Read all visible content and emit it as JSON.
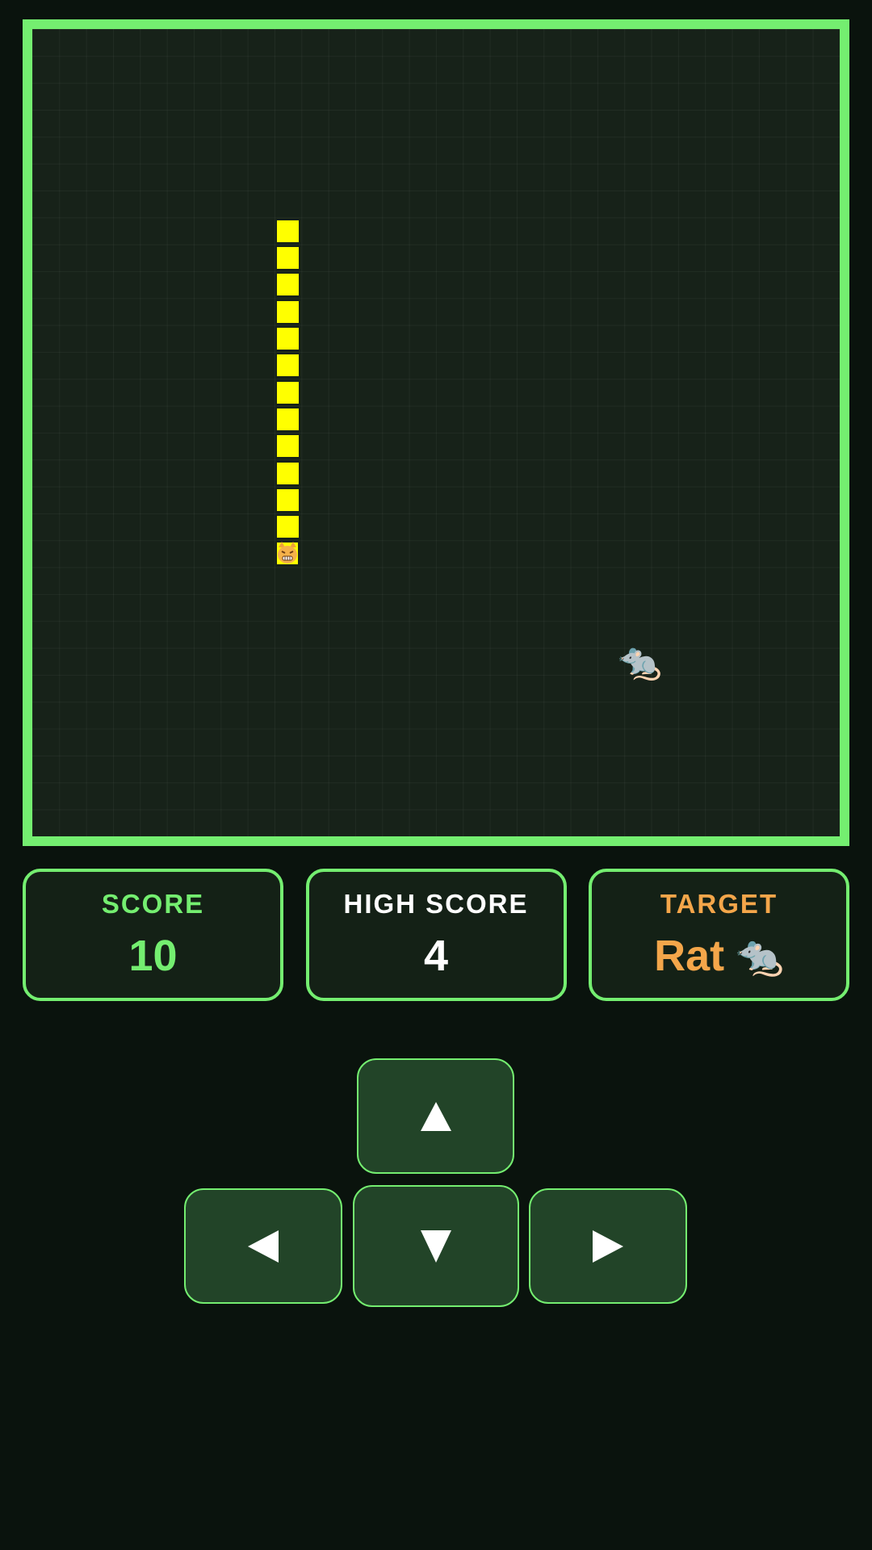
{
  "board": {
    "grid": {
      "columns": 30,
      "rows": 30
    },
    "snake": {
      "head_icon": "tiger-cat-face-icon",
      "head_cell": [
        9,
        19
      ],
      "body_cells": [
        [
          9,
          7
        ],
        [
          9,
          8
        ],
        [
          9,
          9
        ],
        [
          9,
          10
        ],
        [
          9,
          11
        ],
        [
          9,
          12
        ],
        [
          9,
          13
        ],
        [
          9,
          14
        ],
        [
          9,
          15
        ],
        [
          9,
          16
        ],
        [
          9,
          17
        ],
        [
          9,
          18
        ]
      ],
      "color": "#ffff00"
    },
    "food": {
      "icon": "rat-icon",
      "glyph": "🐀",
      "cell": [
        22,
        23
      ]
    },
    "border_color": "#74ee70"
  },
  "stats": {
    "score": {
      "label": "SCORE",
      "value": "10"
    },
    "high_score": {
      "label": "HIGH SCORE",
      "value": "4"
    },
    "target": {
      "label": "TARGET",
      "value": "Rat",
      "glyph": "🐀",
      "icon": "rat-icon"
    }
  },
  "controls": {
    "up": {
      "icon": "arrow-up-icon"
    },
    "left": {
      "icon": "arrow-left-icon"
    },
    "down": {
      "icon": "arrow-down-icon"
    },
    "right": {
      "icon": "arrow-right-icon"
    }
  },
  "colors": {
    "accent": "#74ee70",
    "score": "#74ee70",
    "target": "#f4a64a",
    "button_bg": "#224428",
    "page_bg": "#0a130d"
  }
}
